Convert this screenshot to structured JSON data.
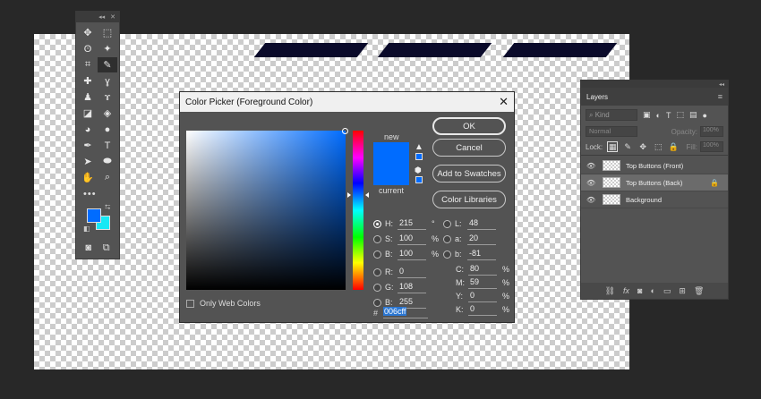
{
  "tools": {
    "items": [
      {
        "name": "move-icon",
        "glyph": "✥"
      },
      {
        "name": "marquee-icon",
        "glyph": "⬚"
      },
      {
        "name": "lasso-icon",
        "glyph": "ʘ"
      },
      {
        "name": "magic-wand-icon",
        "glyph": "✦"
      },
      {
        "name": "crop-icon",
        "glyph": "⌗"
      },
      {
        "name": "eyedropper-icon",
        "glyph": "✎"
      },
      {
        "name": "healing-brush-icon",
        "glyph": "✚"
      },
      {
        "name": "brush-icon",
        "glyph": "ɣ"
      },
      {
        "name": "stamp-icon",
        "glyph": "♟"
      },
      {
        "name": "history-brush-icon",
        "glyph": "ɤ"
      },
      {
        "name": "eraser-icon",
        "glyph": "◪"
      },
      {
        "name": "paint-bucket-icon",
        "glyph": "◈"
      },
      {
        "name": "blur-icon",
        "glyph": "◕"
      },
      {
        "name": "dodge-icon",
        "glyph": "●"
      },
      {
        "name": "pen-icon",
        "glyph": "✒"
      },
      {
        "name": "type-icon",
        "glyph": "T"
      },
      {
        "name": "path-select-icon",
        "glyph": "➤"
      },
      {
        "name": "ellipse-icon",
        "glyph": "⬬"
      },
      {
        "name": "hand-icon",
        "glyph": "✋"
      },
      {
        "name": "zoom-icon",
        "glyph": "⌕"
      }
    ],
    "more": "•••",
    "colors": {
      "foreground": "#006cff",
      "background": "#17e8f5"
    }
  },
  "dialog": {
    "title": "Color Picker (Foreground Color)",
    "close": "✕",
    "new_label": "new",
    "current_label": "current",
    "new_color": "#006cff",
    "current_color": "#006cff",
    "buttons": {
      "ok": "OK",
      "cancel": "Cancel",
      "add_swatches": "Add to Swatches",
      "color_libraries": "Color Libraries"
    },
    "hsb": [
      {
        "label": "H:",
        "value": "215",
        "unit": "°",
        "selected": true
      },
      {
        "label": "S:",
        "value": "100",
        "unit": "%",
        "selected": false
      },
      {
        "label": "B:",
        "value": "100",
        "unit": "%",
        "selected": false
      }
    ],
    "rgb": [
      {
        "label": "R:",
        "value": "0"
      },
      {
        "label": "G:",
        "value": "108"
      },
      {
        "label": "B:",
        "value": "255"
      }
    ],
    "lab": [
      {
        "label": "L:",
        "value": "48"
      },
      {
        "label": "a:",
        "value": "20"
      },
      {
        "label": "b:",
        "value": "-81"
      }
    ],
    "cmyk": [
      {
        "label": "C:",
        "value": "80",
        "unit": "%"
      },
      {
        "label": "M:",
        "value": "59",
        "unit": "%"
      },
      {
        "label": "Y:",
        "value": "0",
        "unit": "%"
      },
      {
        "label": "K:",
        "value": "0",
        "unit": "%"
      }
    ],
    "hex_label": "#",
    "hex_value": "006cff",
    "only_web_colors": "Only Web Colors"
  },
  "layers": {
    "tab": "Layers",
    "kind_placeholder": "Kind",
    "blend_mode": "Normal",
    "opacity_label": "Opacity:",
    "opacity_value": "100%",
    "lock_label": "Lock:",
    "fill_label": "Fill:",
    "fill_value": "100%",
    "items": [
      {
        "name": "Top Buttons (Front)",
        "selected": false,
        "locked": false
      },
      {
        "name": "Top Buttons (Back)",
        "selected": true,
        "locked": true
      },
      {
        "name": "Background",
        "selected": false,
        "locked": false
      }
    ]
  }
}
